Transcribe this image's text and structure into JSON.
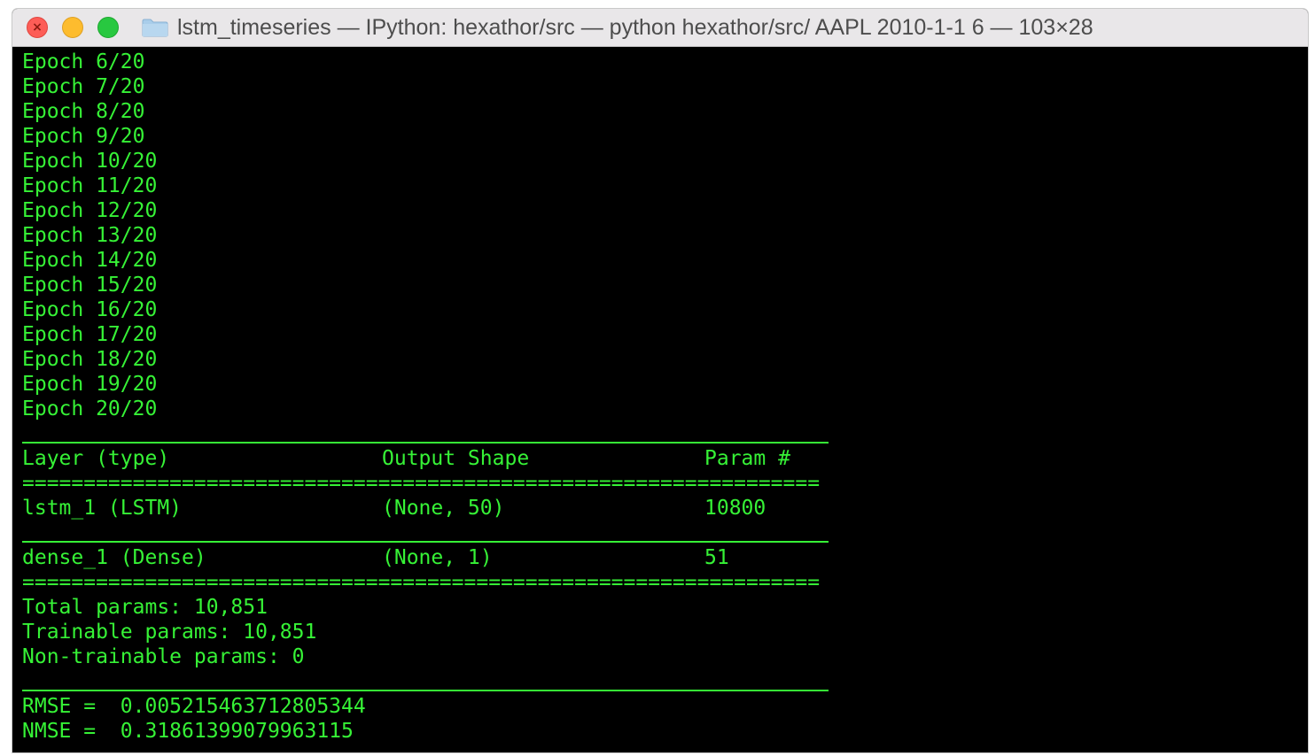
{
  "window": {
    "title": "lstm_timeseries — IPython: hexathor/src — python hexathor/src/ AAPL 2010-1-1 6 — 103×28",
    "controls": {
      "close_icon": "close-icon",
      "minimize_icon": "minimize-icon",
      "maximize_icon": "maximize-icon"
    },
    "folder_icon": "folder-icon"
  },
  "colors": {
    "terminal_bg": "#000000",
    "terminal_text": "#36f236",
    "titlebar_bg": "#e9e7e9"
  },
  "terminal": {
    "epochs": [
      "Epoch 6/20",
      "Epoch 7/20",
      "Epoch 8/20",
      "Epoch 9/20",
      "Epoch 10/20",
      "Epoch 11/20",
      "Epoch 12/20",
      "Epoch 13/20",
      "Epoch 14/20",
      "Epoch 15/20",
      "Epoch 16/20",
      "Epoch 17/20",
      "Epoch 18/20",
      "Epoch 19/20",
      "Epoch 20/20"
    ],
    "summary": {
      "headers": [
        "Layer (type)",
        "Output Shape",
        "Param #"
      ],
      "double_rule": "=================================================================",
      "rows": [
        [
          "lstm_1 (LSTM)",
          "(None, 50)",
          "10800"
        ],
        [
          "dense_1 (Dense)",
          "(None, 1)",
          "51"
        ]
      ],
      "total_params": "Total params: 10,851",
      "trainable_params": "Trainable params: 10,851",
      "non_trainable_params": "Non-trainable params: 0"
    },
    "metrics": {
      "rmse": "RMSE =  0.005215463712805344",
      "nmse": "NMSE =  0.31861399079963115"
    }
  }
}
